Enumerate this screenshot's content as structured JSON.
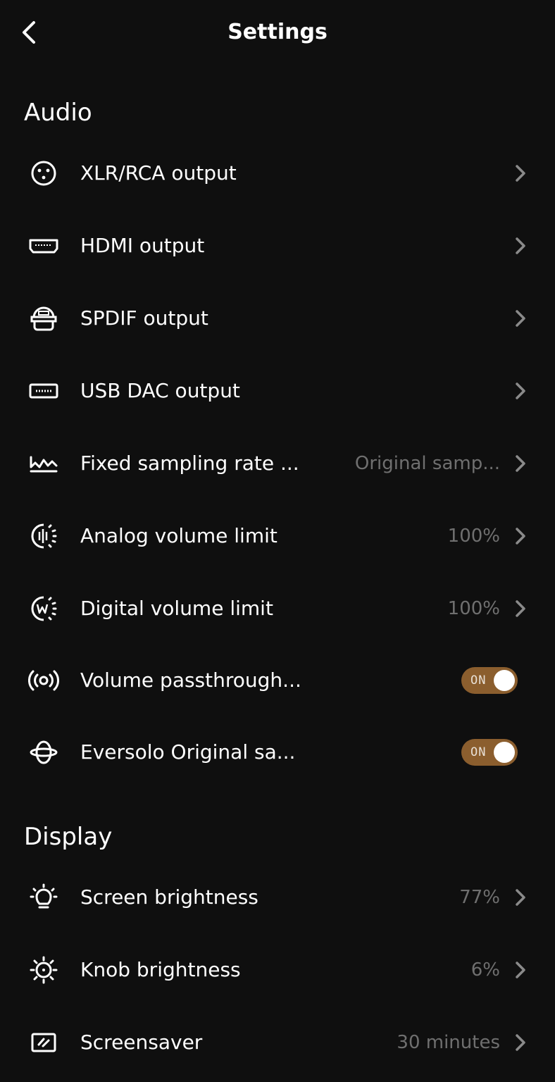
{
  "header": {
    "title": "Settings"
  },
  "sections": [
    {
      "title": "Audio"
    },
    {
      "title": "Display"
    }
  ],
  "audio": {
    "items": [
      {
        "label": "XLR/RCA output",
        "value": "",
        "icon": "xlr-connector-icon"
      },
      {
        "label": "HDMI output",
        "value": "",
        "icon": "hdmi-port-icon"
      },
      {
        "label": "SPDIF output",
        "value": "",
        "icon": "spdif-connector-icon"
      },
      {
        "label": "USB DAC output",
        "value": "",
        "icon": "usb-port-icon"
      },
      {
        "label": "Fixed sampling rate ...",
        "value": "Original samp...",
        "icon": "waveform-icon"
      },
      {
        "label": "Analog volume limit",
        "value": "100%",
        "icon": "analog-volume-icon"
      },
      {
        "label": "Digital volume limit",
        "value": "100%",
        "icon": "digital-volume-icon"
      },
      {
        "label": "Volume passthrough...",
        "toggle": "ON",
        "icon": "broadcast-icon"
      },
      {
        "label": "Eversolo Original sa...",
        "toggle": "ON",
        "icon": "orbit-icon"
      }
    ]
  },
  "display": {
    "items": [
      {
        "label": "Screen brightness",
        "value": "77%",
        "icon": "lightbulb-icon"
      },
      {
        "label": "Knob brightness",
        "value": "6%",
        "icon": "sun-icon"
      },
      {
        "label": "Screensaver",
        "value": "30 minutes",
        "icon": "screensaver-icon"
      }
    ]
  },
  "colors": {
    "background": "#0f0f0f",
    "text": "#ffffff",
    "secondary_text": "#6f6f6f",
    "toggle_on": "#8b5e2e",
    "chevron": "#8a8a8a"
  }
}
